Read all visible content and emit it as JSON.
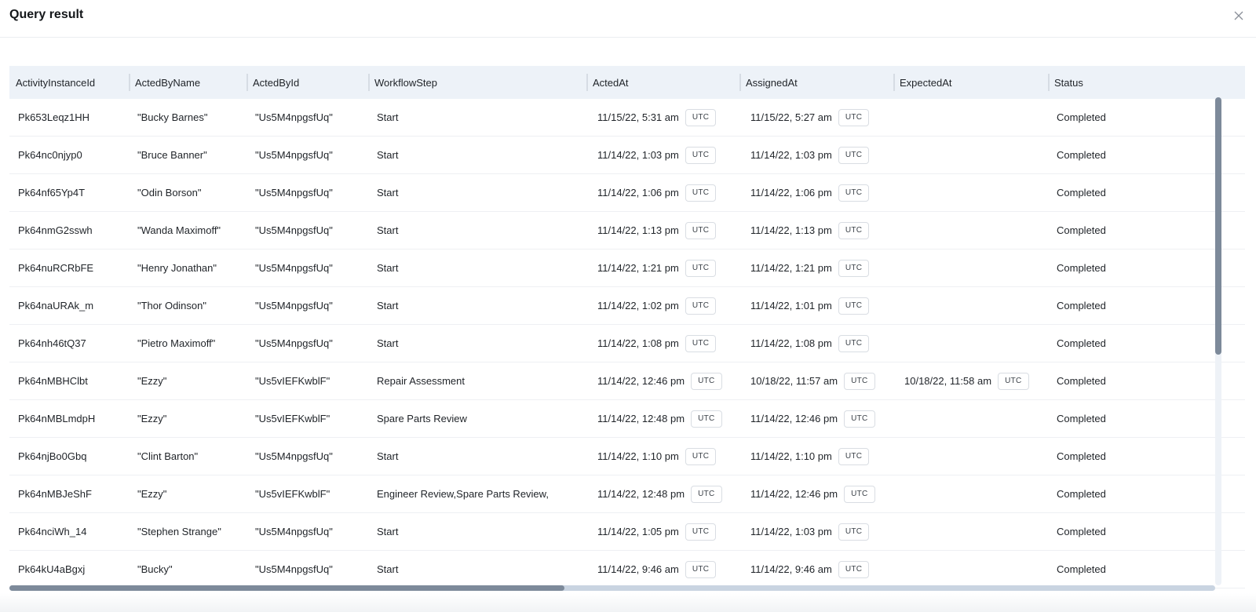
{
  "modal": {
    "title": "Query result",
    "close_icon": "close-icon"
  },
  "table": {
    "columns": [
      "ActivityInstanceId",
      "ActedByName",
      "ActedById",
      "WorkflowStep",
      "ActedAt",
      "AssignedAt",
      "ExpectedAt",
      "Status"
    ],
    "timezone_label": "UTC",
    "rows": [
      {
        "id": "Pk653Leqz1HH",
        "name": "\"Bucky Barnes\"",
        "by": "\"Us5M4npgsfUq\"",
        "step": "Start",
        "acted": "11/15/22, 5:31 am",
        "assigned": "11/15/22, 5:27 am",
        "expected": "",
        "status": "Completed"
      },
      {
        "id": "Pk64nc0njyp0",
        "name": "\"Bruce Banner\"",
        "by": "\"Us5M4npgsfUq\"",
        "step": "Start",
        "acted": "11/14/22, 1:03 pm",
        "assigned": "11/14/22, 1:03 pm",
        "expected": "",
        "status": "Completed"
      },
      {
        "id": "Pk64nf65Yp4T",
        "name": "\"Odin Borson\"",
        "by": "\"Us5M4npgsfUq\"",
        "step": "Start",
        "acted": "11/14/22, 1:06 pm",
        "assigned": "11/14/22, 1:06 pm",
        "expected": "",
        "status": "Completed"
      },
      {
        "id": "Pk64nmG2sswh",
        "name": "\"Wanda Maximoff\"",
        "by": "\"Us5M4npgsfUq\"",
        "step": "Start",
        "acted": "11/14/22, 1:13 pm",
        "assigned": "11/14/22, 1:13 pm",
        "expected": "",
        "status": "Completed"
      },
      {
        "id": "Pk64nuRCRbFE",
        "name": "\"Henry Jonathan\"",
        "by": "\"Us5M4npgsfUq\"",
        "step": "Start",
        "acted": "11/14/22, 1:21 pm",
        "assigned": "11/14/22, 1:21 pm",
        "expected": "",
        "status": "Completed"
      },
      {
        "id": "Pk64naURAk_m",
        "name": "\"Thor Odinson\"",
        "by": "\"Us5M4npgsfUq\"",
        "step": "Start",
        "acted": "11/14/22, 1:02 pm",
        "assigned": "11/14/22, 1:01 pm",
        "expected": "",
        "status": "Completed"
      },
      {
        "id": "Pk64nh46tQ37",
        "name": "\"Pietro Maximoff\"",
        "by": "\"Us5M4npgsfUq\"",
        "step": "Start",
        "acted": "11/14/22, 1:08 pm",
        "assigned": "11/14/22, 1:08 pm",
        "expected": "",
        "status": "Completed"
      },
      {
        "id": "Pk64nMBHClbt",
        "name": "\"Ezzy\"",
        "by": "\"Us5vIEFKwblF\"",
        "step": "Repair Assessment",
        "acted": "11/14/22, 12:46 pm",
        "assigned": "10/18/22, 11:57 am",
        "expected": "10/18/22, 11:58 am",
        "status": "Completed"
      },
      {
        "id": "Pk64nMBLmdpH",
        "name": "\"Ezzy\"",
        "by": "\"Us5vIEFKwblF\"",
        "step": "Spare Parts Review",
        "acted": "11/14/22, 12:48 pm",
        "assigned": "11/14/22, 12:46 pm",
        "expected": "",
        "status": "Completed"
      },
      {
        "id": "Pk64njBo0Gbq",
        "name": "\"Clint Barton\"",
        "by": "\"Us5M4npgsfUq\"",
        "step": "Start",
        "acted": "11/14/22, 1:10 pm",
        "assigned": "11/14/22, 1:10 pm",
        "expected": "",
        "status": "Completed"
      },
      {
        "id": "Pk64nMBJeShF",
        "name": "\"Ezzy\"",
        "by": "\"Us5vIEFKwblF\"",
        "step": "Engineer Review,Spare Parts Review,",
        "acted": "11/14/22, 12:48 pm",
        "assigned": "11/14/22, 12:46 pm",
        "expected": "",
        "status": "Completed"
      },
      {
        "id": "Pk64nciWh_14",
        "name": "\"Stephen Strange\"",
        "by": "\"Us5M4npgsfUq\"",
        "step": "Start",
        "acted": "11/14/22, 1:05 pm",
        "assigned": "11/14/22, 1:03 pm",
        "expected": "",
        "status": "Completed"
      },
      {
        "id": "Pk64kU4aBgxj",
        "name": "\"Bucky\"",
        "by": "\"Us5M4npgsfUq\"",
        "step": "Start",
        "acted": "11/14/22, 9:46 am",
        "assigned": "11/14/22, 9:46 am",
        "expected": "",
        "status": "Completed"
      }
    ]
  }
}
